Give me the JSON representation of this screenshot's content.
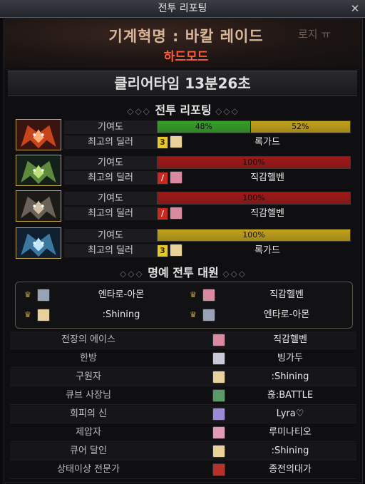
{
  "window": {
    "title": "전투 리포팅",
    "close_symbol": "✕"
  },
  "header": {
    "raid_title": "기계혁명 : 바칼 레이드",
    "difficulty": "하드모드",
    "side_text": "로지 ㅠ"
  },
  "clear_time": "클리어타임 13분26초",
  "report_section": {
    "title": "전투 리포팅",
    "deco": "◇◇◇"
  },
  "colors": {
    "green": "#36a02a",
    "gold": "#c2a21a",
    "red": "#a01818",
    "border_gold": "#c8a84a"
  },
  "bosses": [
    {
      "icon": "fire-dragon-icon",
      "contribution_label": "기여도",
      "dealer_label": "최고의 딜러",
      "segments": [
        {
          "text": "48%",
          "value": 48,
          "color": "#36a02a"
        },
        {
          "text": "52%",
          "value": 52,
          "color": "#c2a21a"
        }
      ],
      "class_badge": "3",
      "avatar_icon": "blonde-character-icon",
      "dealer": "록가드"
    },
    {
      "icon": "green-dragon-icon",
      "contribution_label": "기여도",
      "dealer_label": "최고의 딜러",
      "segments": [
        {
          "text": "100%",
          "value": 100,
          "color": "#a01818"
        }
      ],
      "class_badge": "/",
      "avatar_icon": "pink-character-icon",
      "dealer": "직감헬벤"
    },
    {
      "icon": "metal-dragon-icon",
      "contribution_label": "기여도",
      "dealer_label": "최고의 딜러",
      "segments": [
        {
          "text": "100%",
          "value": 100,
          "color": "#a01818"
        }
      ],
      "class_badge": "/",
      "avatar_icon": "pink-character-icon",
      "dealer": "직감헬벤"
    },
    {
      "icon": "ice-dragon-icon",
      "contribution_label": "기여도",
      "dealer_label": "최고의 딜러",
      "segments": [
        {
          "text": "100%",
          "value": 100,
          "color": "#c2a21a"
        }
      ],
      "class_badge": "3",
      "avatar_icon": "blonde-character-icon",
      "dealer": "록가드"
    }
  ],
  "honor_section": {
    "title": "명예 전투 대원",
    "deco": "◇◇◇",
    "members": [
      {
        "name": "엔타로-아몬",
        "avatar_icon": "silver-character-icon"
      },
      {
        "name": "직감헬벤",
        "avatar_icon": "pink-character-icon"
      },
      {
        "name": ":Shining",
        "avatar_icon": "blonde-character-icon"
      },
      {
        "name": "엔타로-아몬",
        "avatar_icon": "silver-character-icon"
      }
    ]
  },
  "awards": [
    {
      "title": "전장의 에이스",
      "name": "직감헬벤",
      "avatar_icon": "pink-character-icon",
      "avatar_color": "#d98aa0"
    },
    {
      "title": "한방",
      "name": "빙가두",
      "avatar_icon": "white-character-icon",
      "avatar_color": "#c9c9d8"
    },
    {
      "title": "구원자",
      "name": ":Shining",
      "avatar_icon": "blonde-character-icon",
      "avatar_color": "#e8d29a"
    },
    {
      "title": "큐브 사장님",
      "name": "흖:BATTLE",
      "avatar_icon": "green-character-icon",
      "avatar_color": "#5a9a6a"
    },
    {
      "title": "회피의 신",
      "name": "Lyra♡",
      "avatar_icon": "purple-character-icon",
      "avatar_color": "#9a8ad8"
    },
    {
      "title": "제압자",
      "name": "루미나티오",
      "avatar_icon": "pink-character-icon",
      "avatar_color": "#e39ab8"
    },
    {
      "title": "큐어 달인",
      "name": ":Shining",
      "avatar_icon": "blonde-character-icon",
      "avatar_color": "#e8d29a"
    },
    {
      "title": "상태이상 전문가",
      "name": "종전의대가",
      "avatar_icon": "red-character-icon",
      "avatar_color": "#b8302a"
    }
  ]
}
